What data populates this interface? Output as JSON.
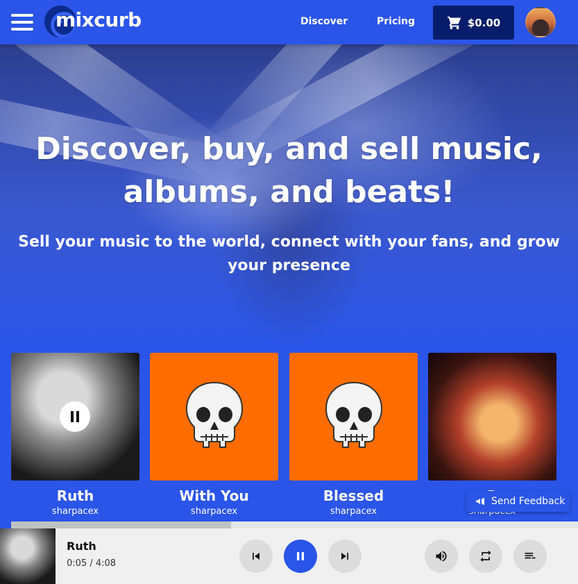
{
  "header": {
    "logo_text": "mixcurb",
    "nav": [
      "Discover",
      "Pricing"
    ],
    "cart_total": "$0.00"
  },
  "hero": {
    "headline": "Discover, buy, and sell music, albums, and beats!",
    "subheadline": "Sell your music to the world, connect with your fans, and grow your presence"
  },
  "albums": [
    {
      "title": "Ruth",
      "artist": "sharpacex",
      "cover": "bw-photo",
      "playing": true
    },
    {
      "title": "With You",
      "artist": "sharpacex",
      "cover": "orange-skull"
    },
    {
      "title": "Blessed",
      "artist": "sharpacex",
      "cover": "orange-skull"
    },
    {
      "title": "R",
      "artist": "sharpacex",
      "cover": "concert-photo"
    }
  ],
  "feedback_label": "Send Feedback",
  "player": {
    "title": "Ruth",
    "time": "0:05 / 4:08",
    "progress": 0.02
  },
  "colors": {
    "brand_blue": "#2a55e8",
    "cart_navy": "#071d6b",
    "cover_orange": "#ff6d00",
    "player_bg": "#f0f0f0"
  },
  "icons": {
    "menu": "hamburger-icon",
    "cart": "cart-icon",
    "pause": "pause-icon",
    "previous": "skip-previous-icon",
    "next": "skip-next-icon",
    "volume": "volume-icon",
    "repeat": "repeat-icon",
    "queue": "queue-icon",
    "feedback": "megaphone-icon"
  }
}
